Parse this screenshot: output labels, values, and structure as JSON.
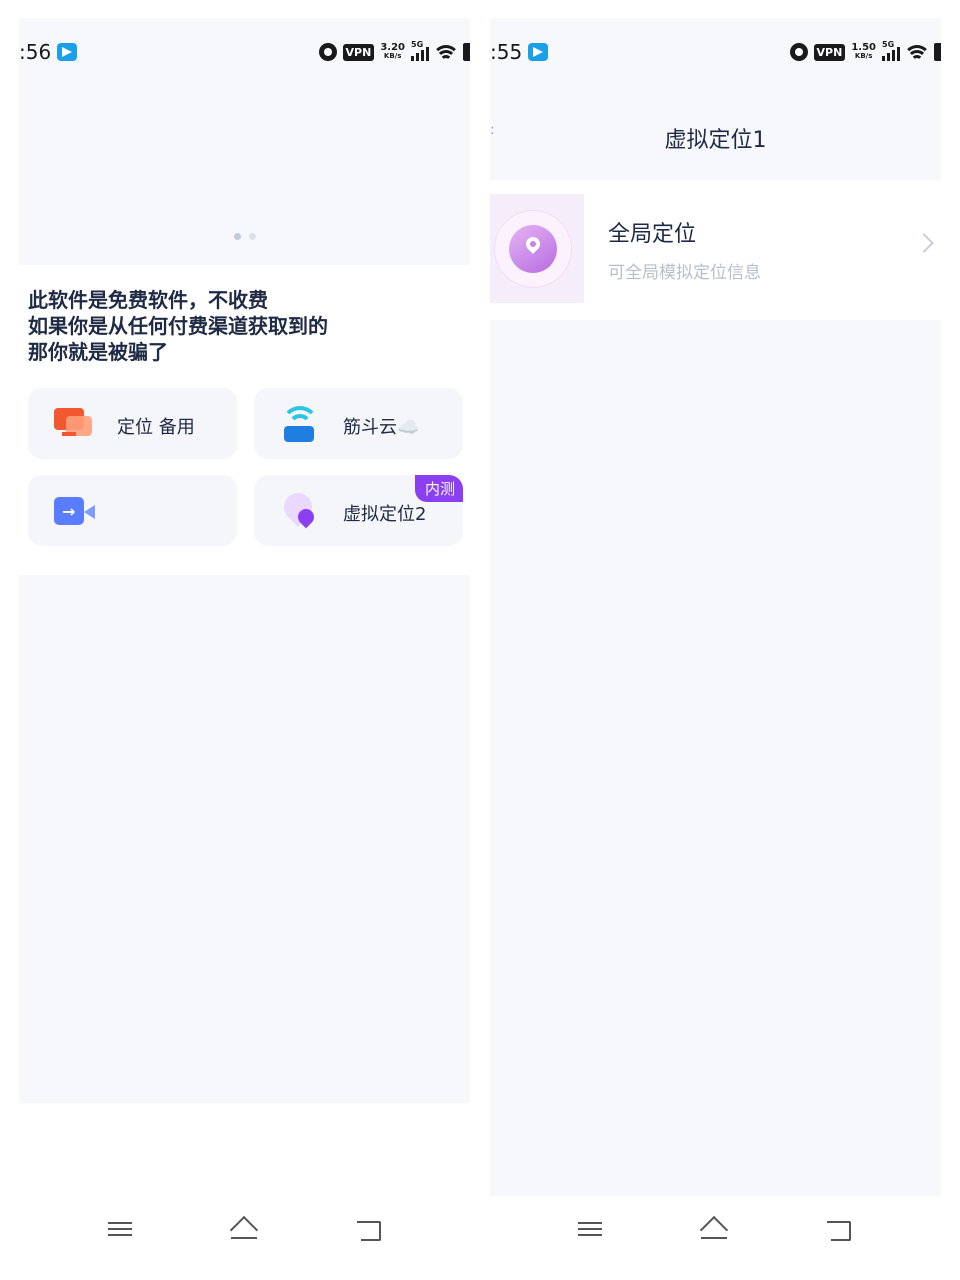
{
  "left": {
    "status": {
      "time": ":56",
      "vpn": "VPN",
      "speed_value": "3.20",
      "speed_unit": "KB/s",
      "network": "5G"
    },
    "notice": [
      "此软件是免费软件，不收费",
      "如果你是从任何付费渠道获取到的",
      "那你就是被骗了"
    ],
    "tiles": [
      {
        "label": "定位 备用",
        "icon": "monitor-icon"
      },
      {
        "label": "筋斗云☁️",
        "icon": "wifi-tower-icon"
      },
      {
        "label": "",
        "icon": "video-forward-icon"
      },
      {
        "label": "虚拟定位2",
        "icon": "location-pin-icon",
        "badge": "内测"
      }
    ]
  },
  "right": {
    "status": {
      "time": ":55",
      "vpn": "VPN",
      "speed_value": "1.50",
      "speed_unit": "KB/s",
      "network": "5G"
    },
    "title": "虚拟定位1",
    "item": {
      "title": "全局定位",
      "subtitle": "可全局模拟定位信息",
      "icon": "location-pin-icon"
    }
  },
  "colors": {
    "accent_purple": "#8a3ff0",
    "background": "#f7f8fb",
    "text": "#1f2a44"
  }
}
